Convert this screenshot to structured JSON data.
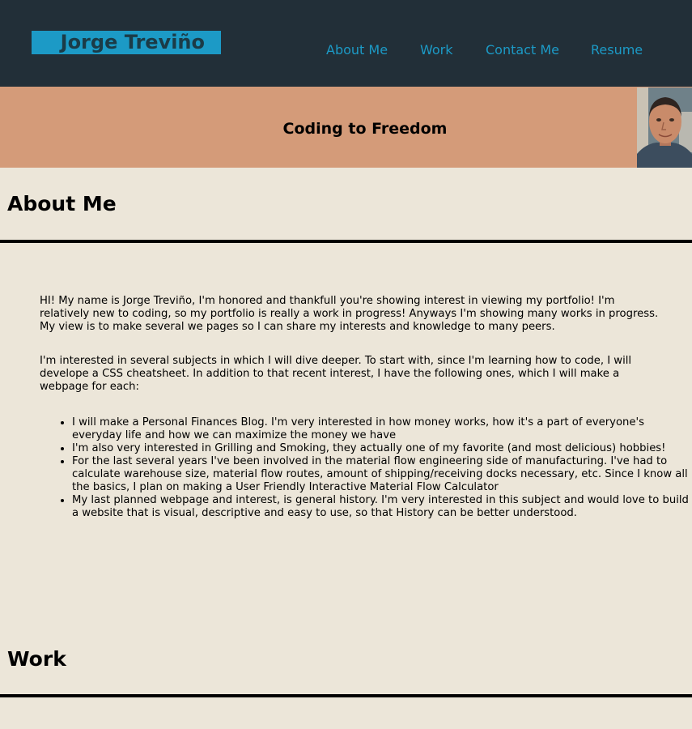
{
  "header": {
    "brand": "Jorge Treviño",
    "nav": [
      "About Me",
      "Work",
      "Contact Me",
      "Resume"
    ]
  },
  "hero": {
    "title": "Coding to Freedom"
  },
  "about": {
    "title": "About Me",
    "paragraphs": [
      "HI! My name is Jorge Treviño, I'm honored and thankfull you're showing interest in viewing my portfolio! I'm relatively new to coding, so my portfolio is really a work in progress! Anyways I'm showing many works in progress. My view is to make several we pages so I can share my interests and knowledge to many peers.",
      "I'm interested in several subjects in which I will dive deeper. To start with, since I'm learning how to code, I will develope a CSS cheatsheet. In addition to that recent interest, I have the following ones, which I will make a webpage for each:"
    ],
    "interests": [
      "I will make a Personal Finances Blog. I'm very interested in how money works, how it's a part of everyone's everyday life and how we can maximize the money we have",
      "I'm also very interested in Grilling and Smoking, they actually one of my favorite (and most delicious) hobbies!",
      "For the last several years I've been involved in the material flow engineering side of manufacturing. I've had to calculate warehouse size, material flow routes, amount of shipping/receiving docks necessary, etc. Since I know all the basics, I plan on making a User Friendly Interactive Material Flow Calculator",
      "My last planned webpage and interest, is general history. I'm very interested in this subject and would love to build a website that is visual, descriptive and easy to use, so that History can be better understood."
    ]
  },
  "work": {
    "title": "Work"
  },
  "colors": {
    "header_bg": "#222f38",
    "accent": "#1c9ac6",
    "hero_bg": "#d49b79",
    "page_bg": "#ece6d9"
  }
}
